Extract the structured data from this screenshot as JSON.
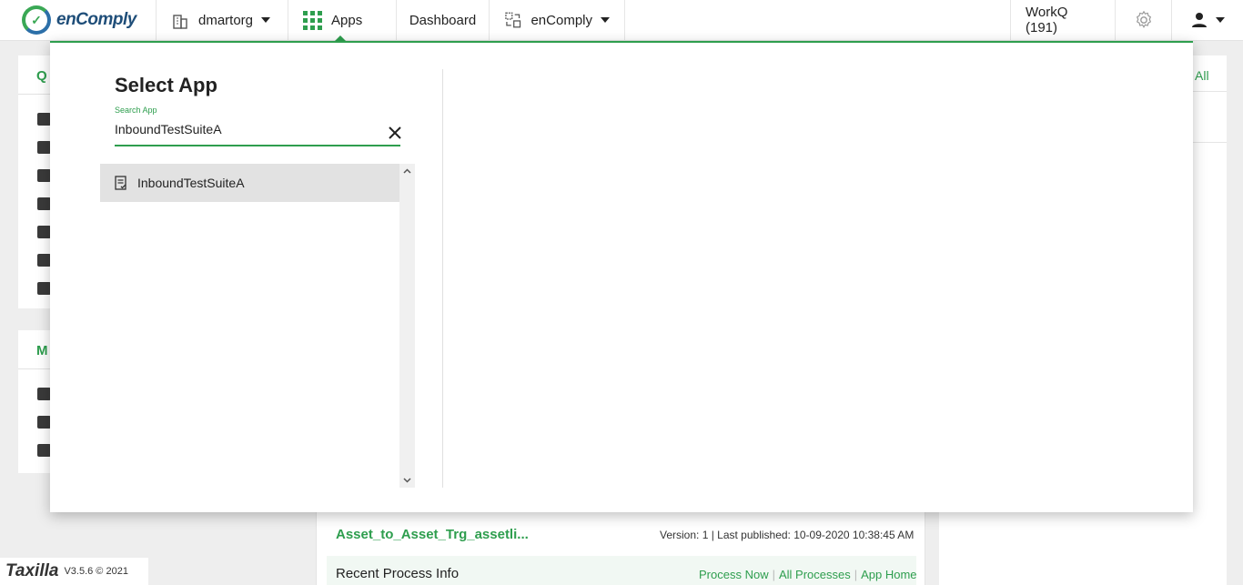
{
  "nav": {
    "logo_text": "enComply",
    "org": "dmartorg",
    "apps": "Apps",
    "dashboard": "Dashboard",
    "app_switch": "enComply",
    "workq": "WorkQ (191)"
  },
  "background": {
    "left_card_initial": "Q",
    "left_card2_initial": "M",
    "right_link": "All",
    "process_title": "Asset_to_Asset_Trg_assetli...",
    "version_info": "Version: 1 | Last published: 10-09-2020 10:38:45 AM",
    "recent_label": "Recent Process Info",
    "links": [
      "Process Now",
      "All Processes",
      "App Home"
    ]
  },
  "footer": {
    "brand": "Taxilla",
    "version": "V3.5.6 © 2021"
  },
  "modal": {
    "title": "Select App",
    "search_label": "Search App",
    "search_value": "InboundTestSuiteA",
    "results": [
      "InboundTestSuiteA"
    ]
  },
  "colors": {
    "accent": "#2e9e4e",
    "brand_blue": "#1f4e79"
  }
}
